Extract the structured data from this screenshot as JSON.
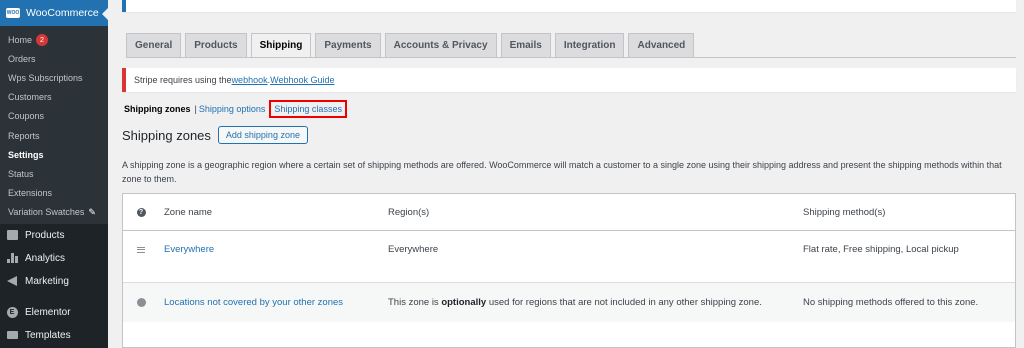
{
  "sidebar": {
    "brand": "WooCommerce",
    "logo_text": "WOO",
    "sub_items": [
      {
        "label": "Home",
        "badge": "2"
      },
      {
        "label": "Orders"
      },
      {
        "label": "Wps Subscriptions"
      },
      {
        "label": "Customers"
      },
      {
        "label": "Coupons"
      },
      {
        "label": "Reports"
      },
      {
        "label": "Settings"
      },
      {
        "label": "Status"
      },
      {
        "label": "Extensions"
      },
      {
        "label": "Variation Swatches"
      }
    ],
    "menu_items": [
      {
        "label": "Products",
        "icon": "products-icon"
      },
      {
        "label": "Analytics",
        "icon": "analytics-icon"
      },
      {
        "label": "Marketing",
        "icon": "marketing-icon"
      },
      {
        "label": "Elementor",
        "icon": "elementor-icon"
      },
      {
        "label": "Templates",
        "icon": "templates-icon"
      }
    ]
  },
  "tabs": [
    "General",
    "Products",
    "Shipping",
    "Payments",
    "Accounts & Privacy",
    "Emails",
    "Integration",
    "Advanced"
  ],
  "active_tab": "Shipping",
  "notice": {
    "text_before": "Stripe requires using the ",
    "link1": "webhook",
    "text_mid": ". ",
    "link2": "Webhook Guide"
  },
  "subsections": {
    "current": "Shipping zones",
    "separator": "|",
    "options": "Shipping options",
    "classes": "Shipping classes"
  },
  "zones": {
    "title": "Shipping zones",
    "add_button": "Add shipping zone",
    "description": "A shipping zone is a geographic region where a certain set of shipping methods are offered. WooCommerce will match a customer to a single zone using their shipping address and present the shipping methods within that zone to them."
  },
  "table": {
    "headers": {
      "name": "Zone name",
      "region": "Region(s)",
      "methods": "Shipping method(s)"
    },
    "rows": [
      {
        "name": "Everywhere",
        "region": "Everywhere",
        "methods": "Flat rate, Free shipping, Local pickup"
      }
    ],
    "fallback": {
      "name": "Locations not covered by your other zones",
      "region_before": "This zone is ",
      "region_bold": "optionally",
      "region_after": " used for regions that are not included in any other shipping zone.",
      "methods": "No shipping methods offered to this zone."
    }
  },
  "colors": {
    "sidebar_bg": "#1d2327",
    "accent": "#2271b1",
    "notice_border": "#d63638",
    "highlight_box": "#ee0000"
  }
}
